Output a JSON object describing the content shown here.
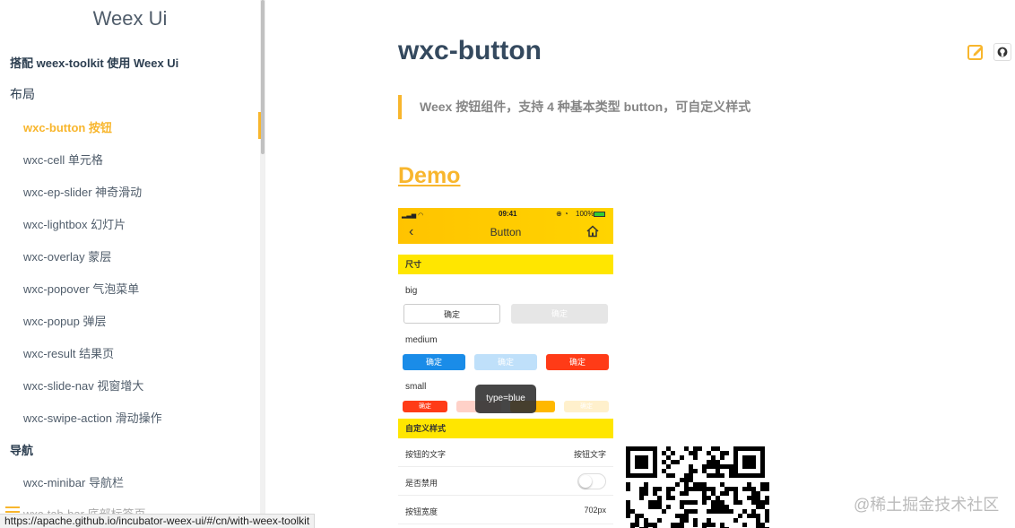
{
  "sidebar": {
    "brand": "Weex Ui",
    "items": [
      {
        "label": "搭配 weex-toolkit 使用 Weex Ui",
        "kind": "section-bold"
      },
      {
        "label": "布局",
        "kind": "section"
      },
      {
        "label": "wxc-button 按钮",
        "kind": "link-active"
      },
      {
        "label": "wxc-cell 单元格",
        "kind": "link"
      },
      {
        "label": "wxc-ep-slider 神奇滑动",
        "kind": "link"
      },
      {
        "label": "wxc-lightbox 幻灯片",
        "kind": "link"
      },
      {
        "label": "wxc-overlay 蒙层",
        "kind": "link"
      },
      {
        "label": "wxc-popover 气泡菜单",
        "kind": "link"
      },
      {
        "label": "wxc-popup 弹层",
        "kind": "link"
      },
      {
        "label": "wxc-result 结果页",
        "kind": "link"
      },
      {
        "label": "wxc-slide-nav 视窗增大",
        "kind": "link"
      },
      {
        "label": "wxc-swipe-action 滑动操作",
        "kind": "link"
      },
      {
        "label": "导航",
        "kind": "section-bold"
      },
      {
        "label": "wxc-minibar 导航栏",
        "kind": "link"
      },
      {
        "label": "wxc-tab-bar 底部标签页",
        "kind": "link"
      }
    ]
  },
  "status_url": "https://apache.github.io/incubator-weex-ui/#/cn/with-weex-toolkit",
  "main": {
    "title": "wxc-button",
    "quote": "Weex 按钮组件，支持 4 种基本类型 button，可自定义样式",
    "demo_heading": "Demo"
  },
  "phone": {
    "time": "09:41",
    "battery": "100%",
    "nav_title": "Button",
    "back_glyph": "‹",
    "band_size": "尺寸",
    "label_big": "big",
    "label_medium": "medium",
    "label_small": "small",
    "confirm": "确定",
    "tooltip": "type=blue",
    "band_custom": "自定义样式",
    "rows": [
      {
        "label": "按钮的文字",
        "value": "按钮文字"
      },
      {
        "label": "是否禁用",
        "value": ""
      },
      {
        "label": "按钮宽度",
        "value": "702px"
      }
    ]
  },
  "watermark": "@稀土掘金技术社区",
  "colors": {
    "accent": "#f8b62d",
    "title": "#34495e",
    "phone_header": "#ffc300",
    "band": "#ffe600",
    "blue": "#1a8ce8",
    "red": "#ff3b17"
  }
}
